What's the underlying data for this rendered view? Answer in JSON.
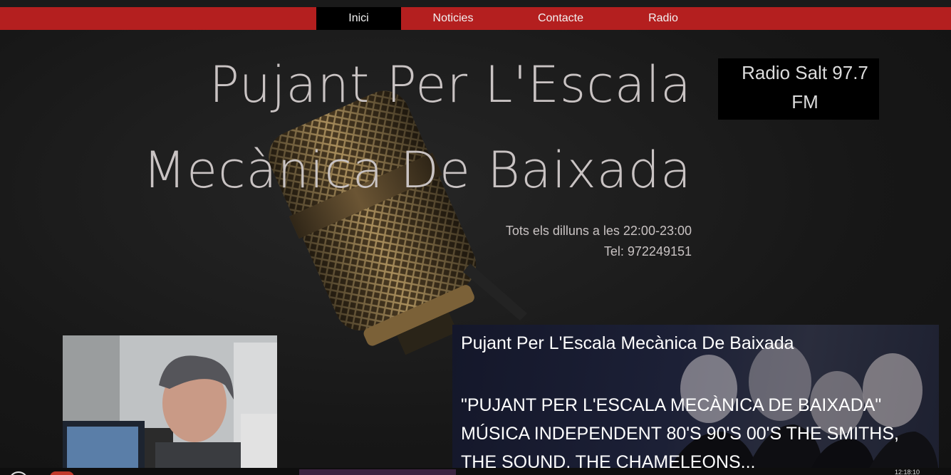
{
  "nav": {
    "items": [
      {
        "label": "Inici",
        "active": true
      },
      {
        "label": "Noticies",
        "active": false
      },
      {
        "label": "Contacte",
        "active": false
      },
      {
        "label": "Radio",
        "active": false
      }
    ]
  },
  "hero": {
    "title_line1": "Pujant Per L'Escala",
    "title_line2": "Mecànica De Baixada",
    "schedule": "Tots els dilluns a les 22:00-23:00",
    "phone": "Tel: 972249151"
  },
  "station": {
    "line1": "Radio Salt 97.7",
    "line2": "FM"
  },
  "card": {
    "title": "Pujant Per L'Escala Mecànica De Baixada",
    "description": "\"PUJANT PER L'ESCALA MECÀNICA DE BAIXADA\" MÚSICA INDEPENDENT 80'S 90'S 00'S THE SMITHS, THE SOUND, THE CHAMELEONS..."
  },
  "taskbar": {
    "clock": "12:18:10"
  },
  "colors": {
    "nav_bg": "#b41f1f",
    "nav_active": "#000000",
    "page_bg": "#1b1b1b",
    "title_text": "#c9c3c3"
  }
}
